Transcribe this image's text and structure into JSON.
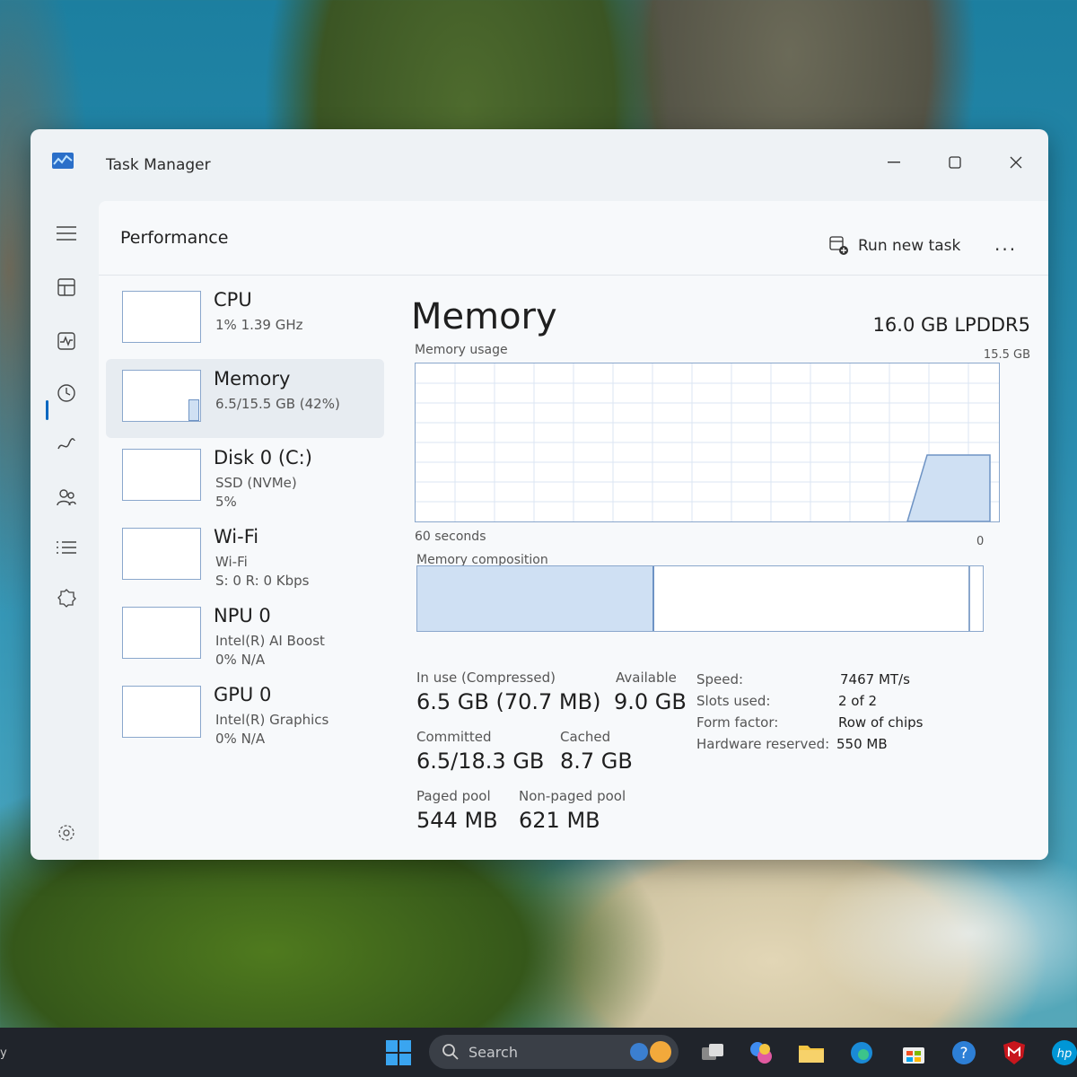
{
  "window": {
    "title": "Task Manager"
  },
  "header": {
    "page_title": "Performance",
    "run_new_task": "Run new task",
    "more": "..."
  },
  "devices": [
    {
      "name": "CPU",
      "sub1": "1% 1.39 GHz",
      "sub2": ""
    },
    {
      "name": "Memory",
      "sub1": "6.5/15.5 GB (42%)",
      "sub2": ""
    },
    {
      "name": "Disk 0 (C:)",
      "sub1": "SSD (NVMe)",
      "sub2": "5%"
    },
    {
      "name": "Wi-Fi",
      "sub1": "Wi-Fi",
      "sub2": "S: 0 R: 0 Kbps"
    },
    {
      "name": "NPU 0",
      "sub1": "Intel(R) AI Boost",
      "sub2": "0% N/A"
    },
    {
      "name": "GPU 0",
      "sub1": "Intel(R) Graphics",
      "sub2": "0% N/A"
    }
  ],
  "detail": {
    "title": "Memory",
    "type": "16.0 GB LPDDR5",
    "usage_label": "Memory usage",
    "usage_max": "15.5 GB",
    "time_span": "60 seconds",
    "axis_zero": "0",
    "composition_label": "Memory composition",
    "in_use_fraction": 0.42,
    "stats": {
      "in_use_label": "In use (Compressed)",
      "in_use_value": "6.5 GB (70.7 MB)",
      "available_label": "Available",
      "available_value": "9.0 GB",
      "committed_label": "Committed",
      "committed_value": "6.5/18.3 GB",
      "cached_label": "Cached",
      "cached_value": "8.7 GB",
      "paged_label": "Paged pool",
      "paged_value": "544 MB",
      "nonpaged_label": "Non-paged pool",
      "nonpaged_value": "621 MB"
    },
    "props": {
      "speed_label": "Speed:",
      "speed_value": "7467 MT/s",
      "slots_label": "Slots used:",
      "slots_value": "2 of 2",
      "form_label": "Form factor:",
      "form_value": "Row of chips",
      "reserved_label": "Hardware reserved:",
      "reserved_value": "550 MB"
    }
  },
  "taskbar": {
    "search_placeholder": "Search",
    "edge_text": "y"
  },
  "colors": {
    "accent": "#0067c0",
    "graph_border": "#8aa7cc",
    "graph_fill": "#cfe0f3"
  }
}
